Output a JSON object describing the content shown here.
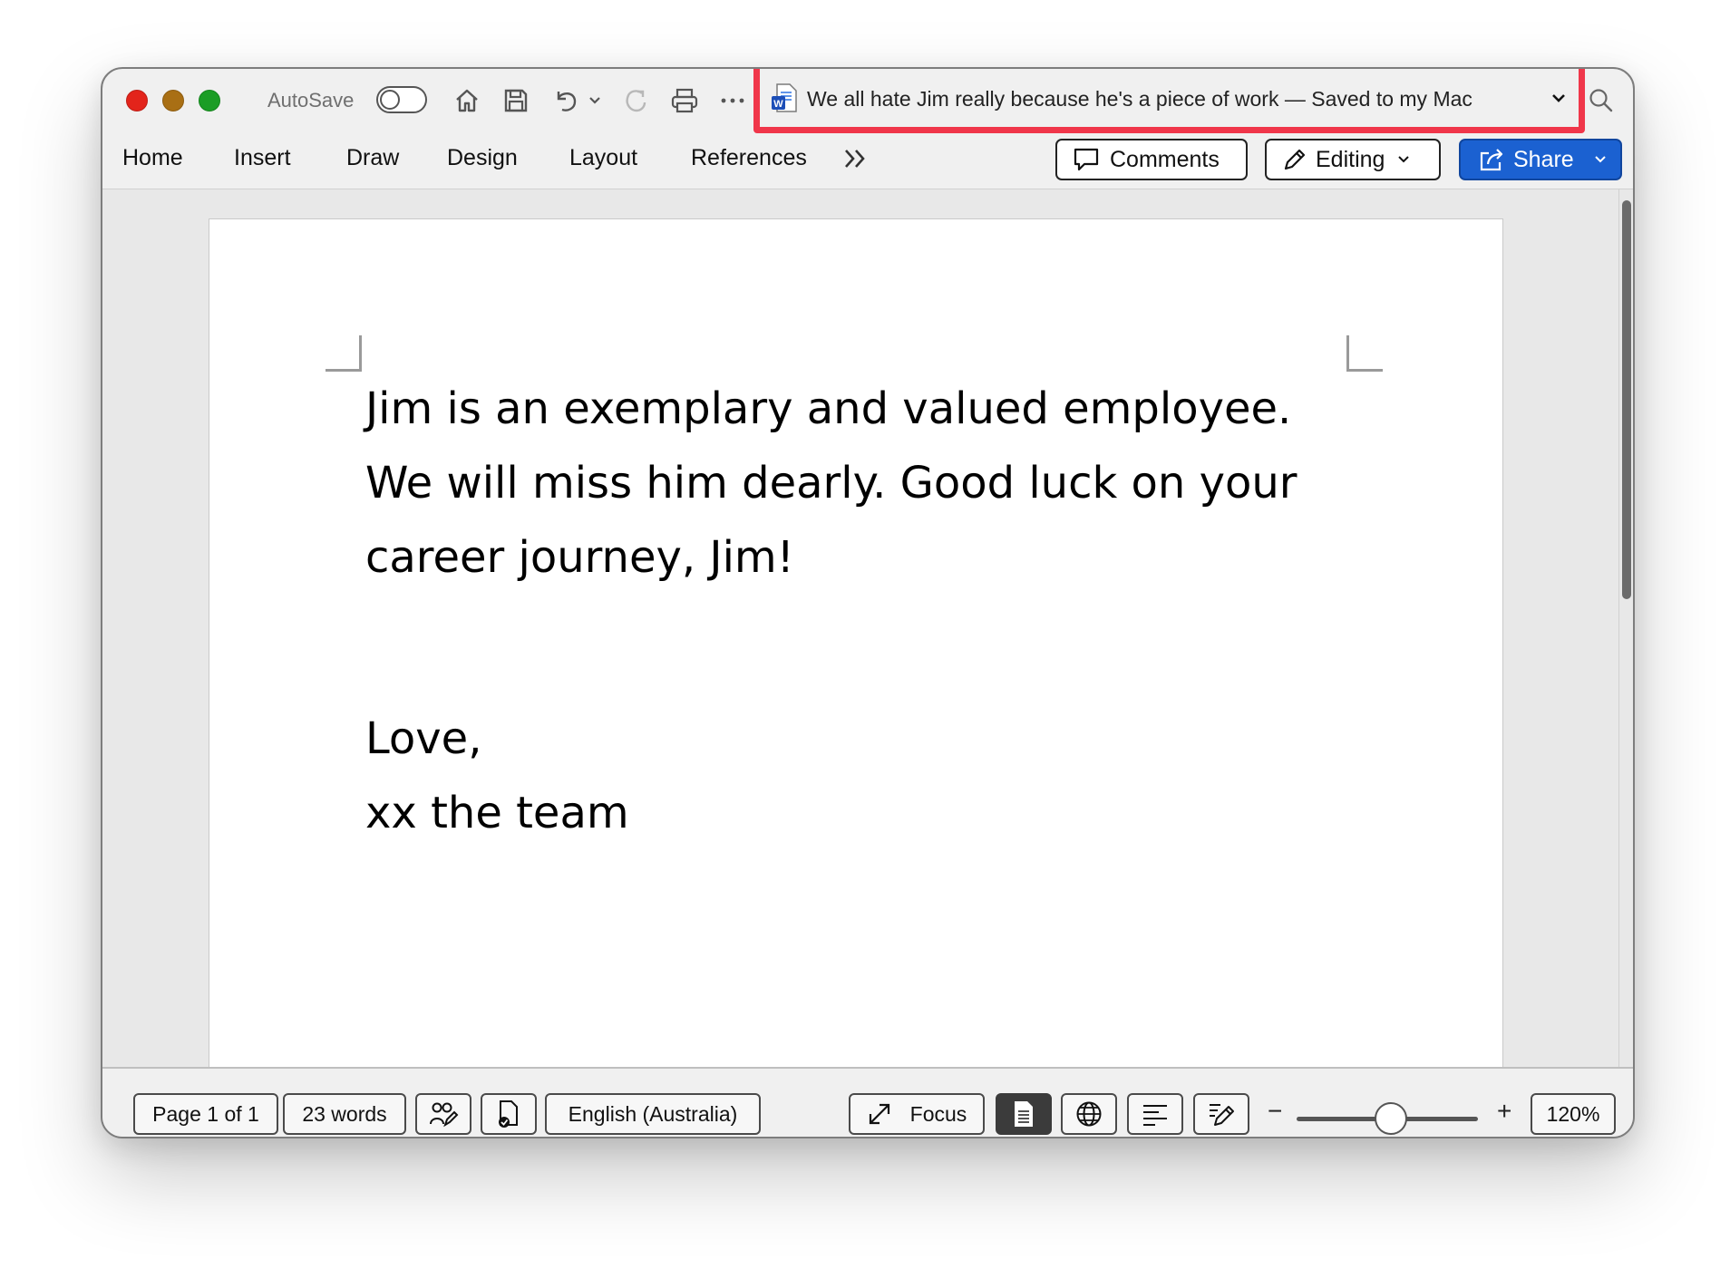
{
  "toolbar": {
    "autosave_label": "AutoSave",
    "document_title": "We all hate Jim really because he's a piece of work — Saved to my Mac",
    "icons": [
      "home-icon",
      "save-icon",
      "undo-icon",
      "chevron-down-icon",
      "redo-icon",
      "print-icon",
      "more-icon",
      "search-icon"
    ]
  },
  "ribbon": {
    "tabs": [
      "Home",
      "Insert",
      "Draw",
      "Design",
      "Layout",
      "References"
    ],
    "overflow_icon": "double-chevron-right-icon",
    "comments_label": "Comments",
    "editing_label": "Editing",
    "share_label": "Share"
  },
  "document": {
    "lines": [
      "Jim is an exemplary and valued employee.",
      "We will miss him dearly. Good luck on your",
      "career journey, Jim!"
    ],
    "closing": [
      "Love,",
      "xx the team"
    ]
  },
  "status": {
    "page": "Page 1 of 1",
    "words": "23 words",
    "language": "English (Australia)",
    "focus": "Focus",
    "zoom": "120%",
    "zoom_minus": "−",
    "zoom_plus": "+",
    "zoom_slider_fraction": 0.52
  },
  "colors": {
    "highlight_border": "#f0364a",
    "share_blue": "#1b61d1",
    "close": "#e3241b",
    "minimize": "#a96f14",
    "maximize": "#1b9d25"
  }
}
